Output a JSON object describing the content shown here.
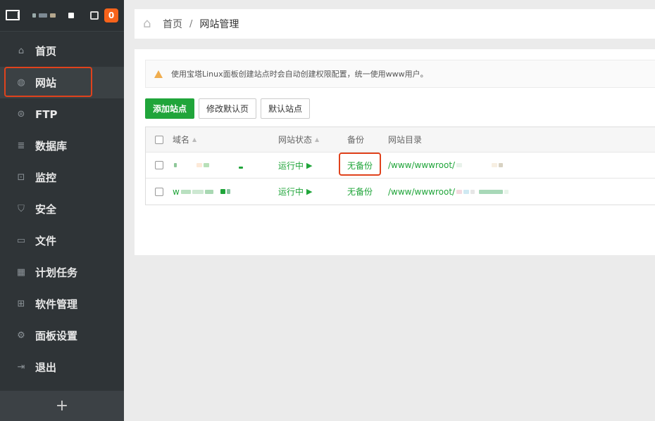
{
  "sidebar": {
    "badge_count": "0",
    "items": [
      {
        "label": "首页",
        "icon": "home-icon",
        "glyph": "⌂",
        "active": false
      },
      {
        "label": "网站",
        "icon": "globe-icon",
        "glyph": "◍",
        "active": true
      },
      {
        "label": "FTP",
        "icon": "ftp-icon",
        "glyph": "⊜",
        "active": false
      },
      {
        "label": "数据库",
        "icon": "database-icon",
        "glyph": "≣",
        "active": false
      },
      {
        "label": "监控",
        "icon": "monitor-chart-icon",
        "glyph": "⊡",
        "active": false
      },
      {
        "label": "安全",
        "icon": "shield-icon",
        "glyph": "⛉",
        "active": false
      },
      {
        "label": "文件",
        "icon": "folder-icon",
        "glyph": "▭",
        "active": false
      },
      {
        "label": "计划任务",
        "icon": "calendar-icon",
        "glyph": "▦",
        "active": false
      },
      {
        "label": "软件管理",
        "icon": "apps-grid-icon",
        "glyph": "⊞",
        "active": false
      },
      {
        "label": "面板设置",
        "icon": "gear-icon",
        "glyph": "⚙",
        "active": false
      },
      {
        "label": "退出",
        "icon": "logout-icon",
        "glyph": "⇥",
        "active": false
      }
    ],
    "add_glyph": "+"
  },
  "breadcrumb": {
    "home": "首页",
    "separator": "/",
    "current": "网站管理"
  },
  "alert": {
    "text": "使用宝塔Linux面板创建站点时会自动创建权限配置，统一使用www用户。"
  },
  "toolbar": {
    "add_site": "添加站点",
    "edit_default_page": "修改默认页",
    "default_site": "默认站点"
  },
  "table": {
    "headers": {
      "domain": "域名",
      "status": "网站状态",
      "backup": "备份",
      "path": "网站目录"
    },
    "rows": [
      {
        "domain_prefix": "",
        "status": "运行中",
        "status_glyph": "▶",
        "backup": "无备份",
        "path": "/www/wwwroot/"
      },
      {
        "domain_prefix": "w",
        "status": "运行中",
        "status_glyph": "▶",
        "backup": "无备份",
        "path": "/www/wwwroot/"
      }
    ]
  },
  "colors": {
    "accent_green": "#20a53a",
    "highlight_red": "#e0421c",
    "badge_orange": "#f7631b",
    "sidebar_bg": "#2f3437"
  }
}
